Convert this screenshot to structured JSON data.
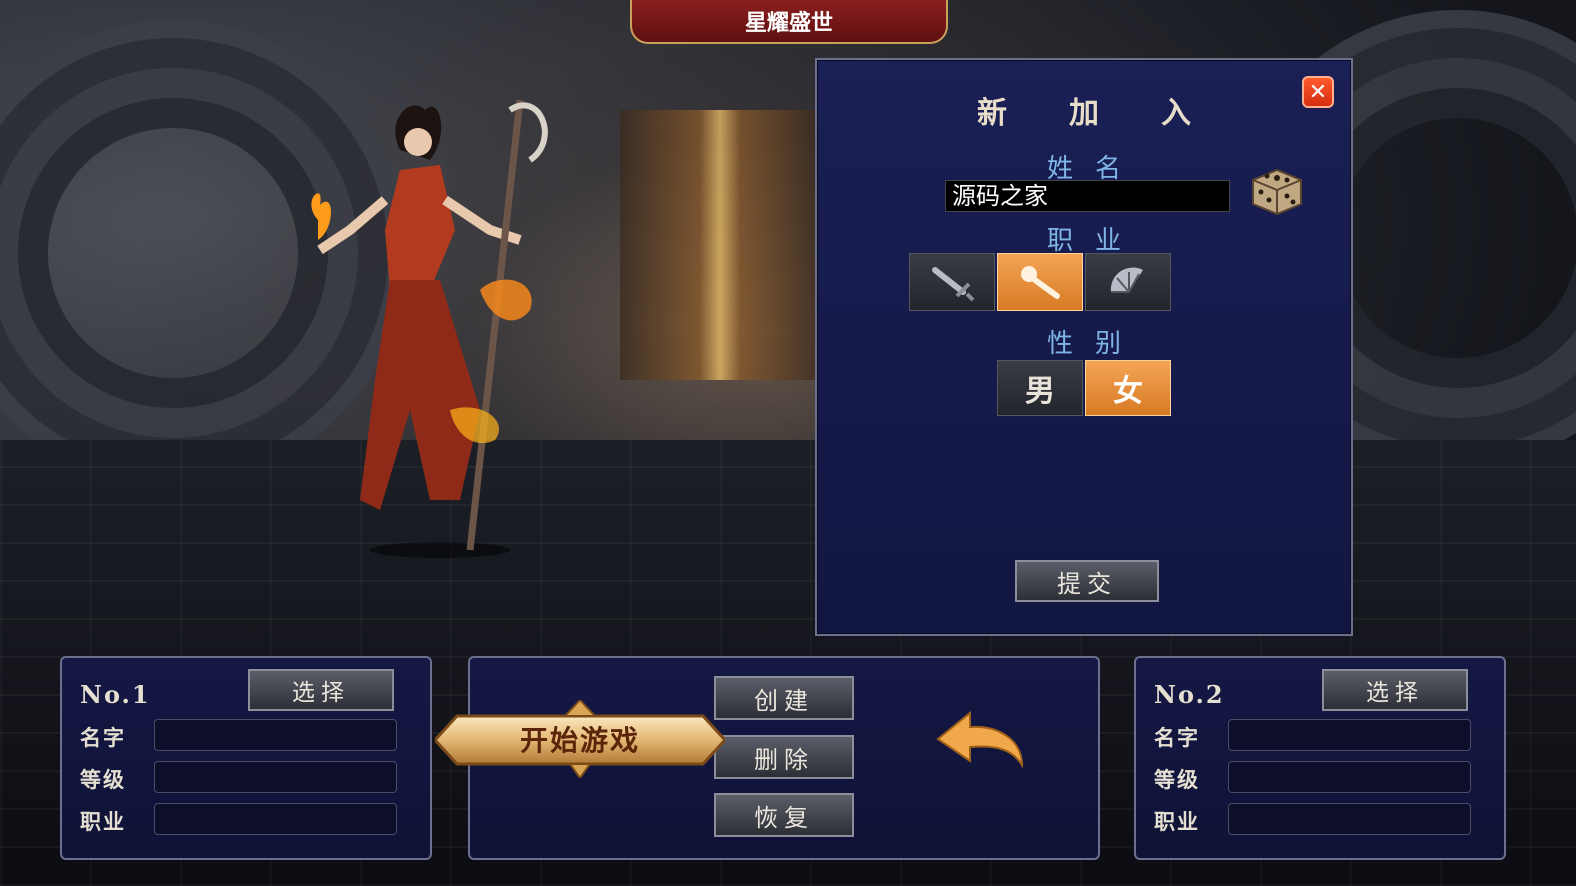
{
  "banner": {
    "title": "星耀盛世"
  },
  "create_panel": {
    "title": "新加入",
    "close_label": "✕",
    "name_label": "姓名",
    "name_value": "源码之家",
    "class_label": "职业",
    "classes": [
      {
        "icon": "sword-icon",
        "selected": false
      },
      {
        "icon": "staff-icon",
        "selected": true
      },
      {
        "icon": "fan-icon",
        "selected": false
      }
    ],
    "gender_label": "性别",
    "genders": [
      {
        "label": "男",
        "selected": false
      },
      {
        "label": "女",
        "selected": true
      }
    ],
    "submit_label": "提交"
  },
  "slot1": {
    "number": "No.1",
    "select_label": "选择",
    "name_label": "名字",
    "level_label": "等级",
    "class_label": "职业"
  },
  "slot2": {
    "number": "No.2",
    "select_label": "选择",
    "name_label": "名字",
    "level_label": "等级",
    "class_label": "职业"
  },
  "actions": {
    "start_label": "开始游戏",
    "create_label": "创建",
    "delete_label": "删除",
    "restore_label": "恢复"
  },
  "colors": {
    "accent": "#e8902f",
    "panel": "#161a4c",
    "banner": "#7a1a1a"
  }
}
